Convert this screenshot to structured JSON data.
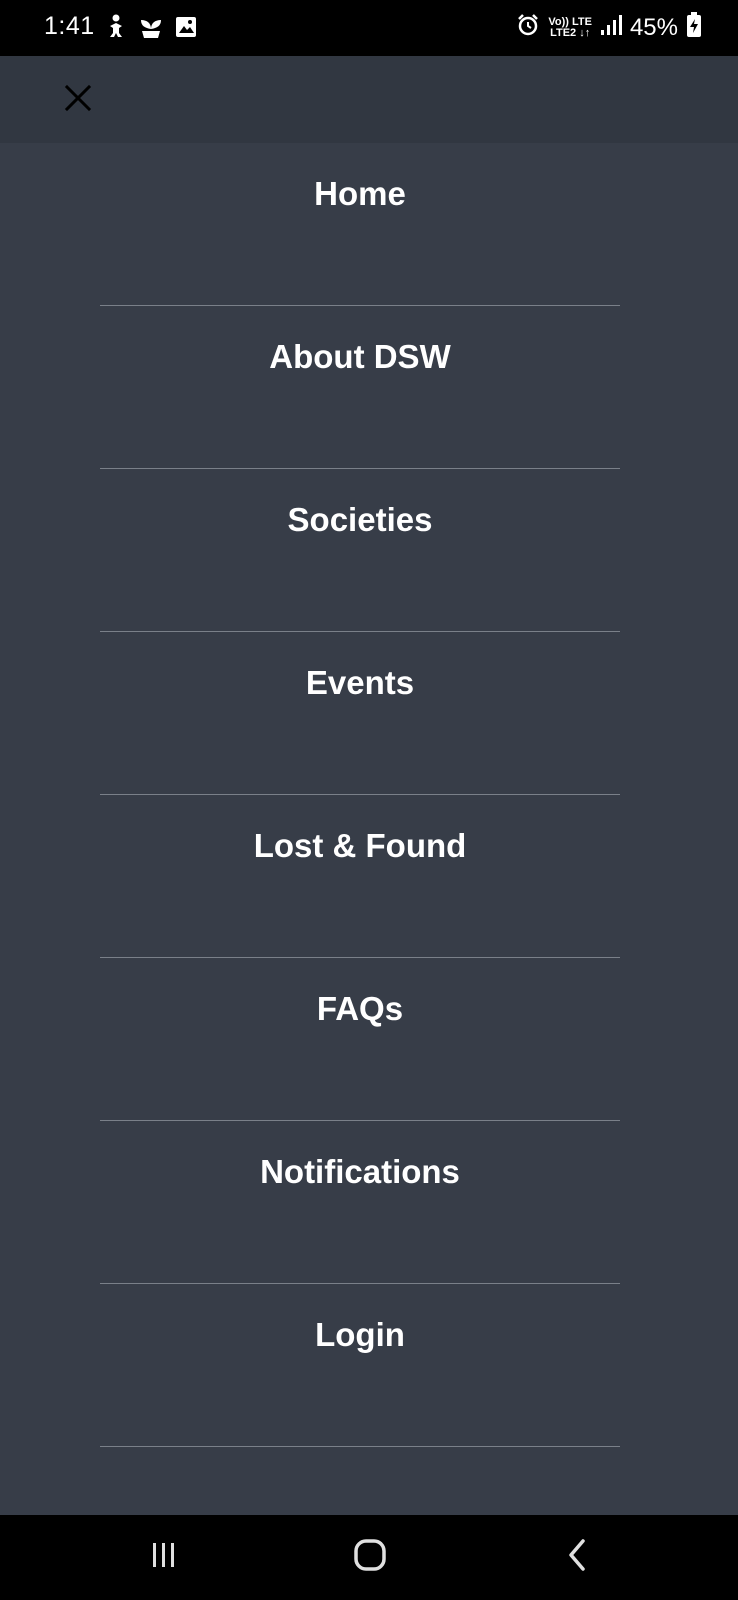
{
  "status_bar": {
    "time": "1:41",
    "net_top": "Vo)) LTE",
    "net_bottom": "LTE2 ↓↑",
    "battery": "45%",
    "icons": [
      "child-icon",
      "seedling-icon",
      "image-icon",
      "alarm-icon",
      "signal-icon",
      "battery-charging-icon"
    ]
  },
  "header": {
    "close_icon": "close-icon"
  },
  "menu": {
    "items": [
      {
        "label": "Home"
      },
      {
        "label": "About DSW"
      },
      {
        "label": "Societies"
      },
      {
        "label": "Events"
      },
      {
        "label": "Lost & Found"
      },
      {
        "label": "FAQs"
      },
      {
        "label": "Notifications"
      },
      {
        "label": "Login"
      }
    ]
  },
  "nav_bar": {
    "icons": [
      "recents-icon",
      "home-icon",
      "back-icon"
    ]
  },
  "colors": {
    "background": "#373d48",
    "header": "#313741",
    "divider": "#7a8089",
    "text": "#ffffff",
    "system_bars": "#000000"
  }
}
